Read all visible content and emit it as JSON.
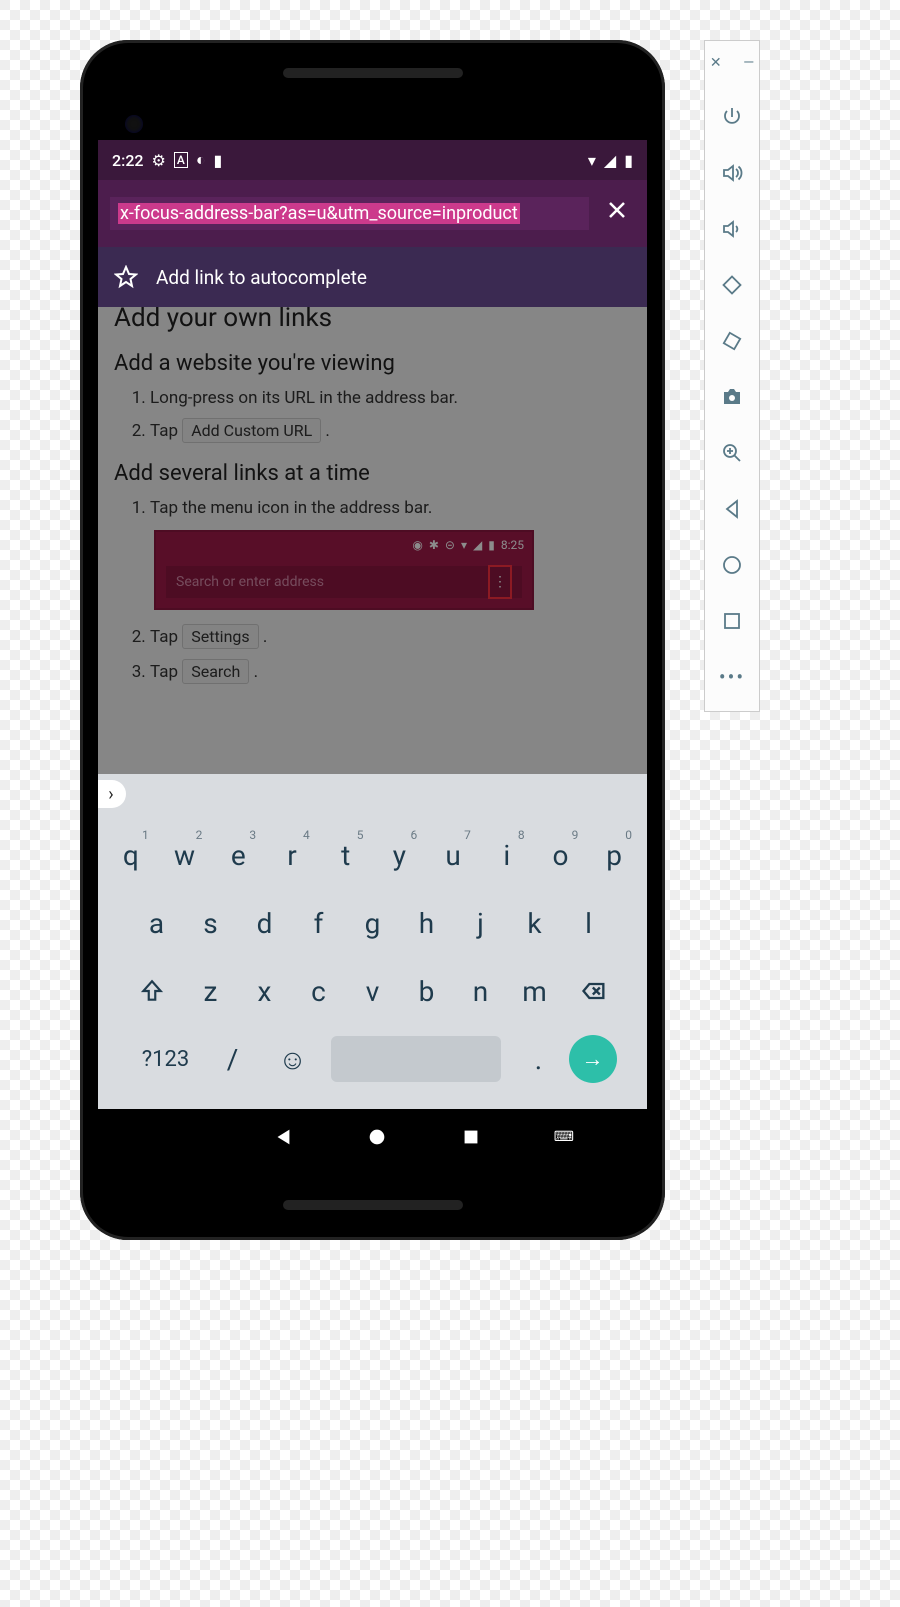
{
  "status": {
    "time": "2:22",
    "icons_left": [
      "gear",
      "card",
      "firefox",
      "sd"
    ],
    "icons_right": [
      "wifi",
      "signal",
      "battery"
    ]
  },
  "address_bar": {
    "url_text": "x-focus-address-bar?as=u&utm_source=inproduct",
    "close": "✕"
  },
  "autocomplete": {
    "label": "Add link to autocomplete"
  },
  "page": {
    "h1_cut": "Add your own links",
    "h2a": "Add a website you're viewing",
    "list_a": [
      "Long-press on its URL in the address bar.",
      "Tap"
    ],
    "pill_a": "Add Custom URL",
    "h2b": "Add several links at a time",
    "list_b": [
      "Tap the menu icon in the address bar.",
      "Tap",
      "Tap"
    ],
    "pill_b1": "Settings",
    "pill_b2": "Search",
    "demo": {
      "time": "8:25",
      "placeholder": "Search or enter address"
    }
  },
  "keyboard": {
    "row1": [
      [
        "q",
        "1"
      ],
      [
        "w",
        "2"
      ],
      [
        "e",
        "3"
      ],
      [
        "r",
        "4"
      ],
      [
        "t",
        "5"
      ],
      [
        "y",
        "6"
      ],
      [
        "u",
        "7"
      ],
      [
        "i",
        "8"
      ],
      [
        "o",
        "9"
      ],
      [
        "p",
        "0"
      ]
    ],
    "row2": [
      "a",
      "s",
      "d",
      "f",
      "g",
      "h",
      "j",
      "k",
      "l"
    ],
    "row3": [
      "z",
      "x",
      "c",
      "v",
      "b",
      "n",
      "m"
    ],
    "symkey": "?123",
    "slash": "/",
    "dot": "."
  },
  "emulator": {
    "buttons": [
      "power",
      "vol-up",
      "vol-down",
      "rotate-left",
      "rotate-right",
      "camera",
      "zoom",
      "back",
      "home",
      "overview",
      "more"
    ]
  }
}
